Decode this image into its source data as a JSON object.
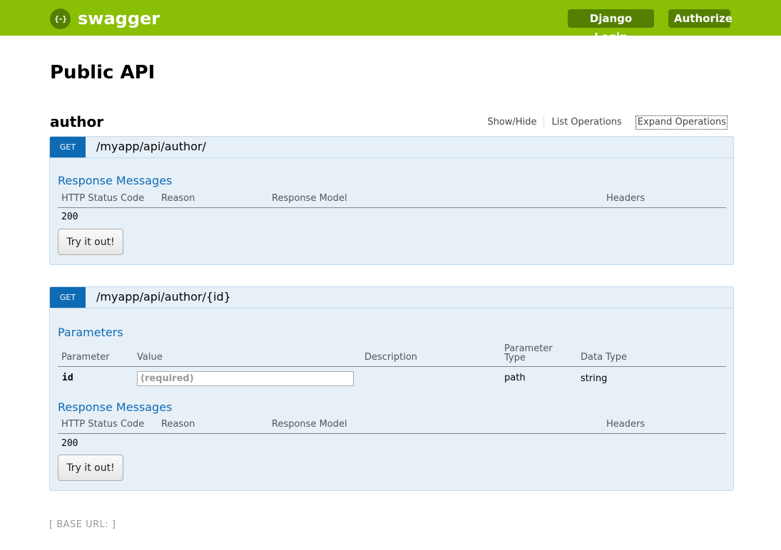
{
  "header": {
    "logo_glyph": "{-}",
    "logo_text": "swagger",
    "django_login": "Django Login",
    "authorize": "Authorize",
    "bar_color": "#89bf04",
    "button_color": "#547f00"
  },
  "page": {
    "title": "Public API"
  },
  "resource": {
    "name": "author",
    "links": [
      "Show/Hide",
      "List Operations",
      "Expand Operations"
    ]
  },
  "operations": [
    {
      "verb": "GET",
      "path": "/myapp/api/author/",
      "response_title": "Response Messages",
      "response_headers": [
        "HTTP Status Code",
        "Reason",
        "Response Model",
        "Headers"
      ],
      "response_rows": [
        {
          "code": "200"
        }
      ],
      "try_label": "Try it out!"
    },
    {
      "verb": "GET",
      "path": "/myapp/api/author/{id}",
      "params_title": "Parameters",
      "param_headers": [
        "Parameter",
        "Value",
        "Description",
        "Parameter Type",
        "Data Type"
      ],
      "params": [
        {
          "name": "id",
          "placeholder": "(required)",
          "type": "path",
          "data_type": "string"
        }
      ],
      "response_title": "Response Messages",
      "response_headers": [
        "HTTP Status Code",
        "Reason",
        "Response Model",
        "Headers"
      ],
      "response_rows": [
        {
          "code": "200"
        }
      ],
      "try_label": "Try it out!"
    }
  ],
  "footer": {
    "base_url": "[ BASE URL: ]"
  },
  "colors": {
    "verb_get": "#0f6ab4",
    "op_background": "#e7f0f7"
  }
}
